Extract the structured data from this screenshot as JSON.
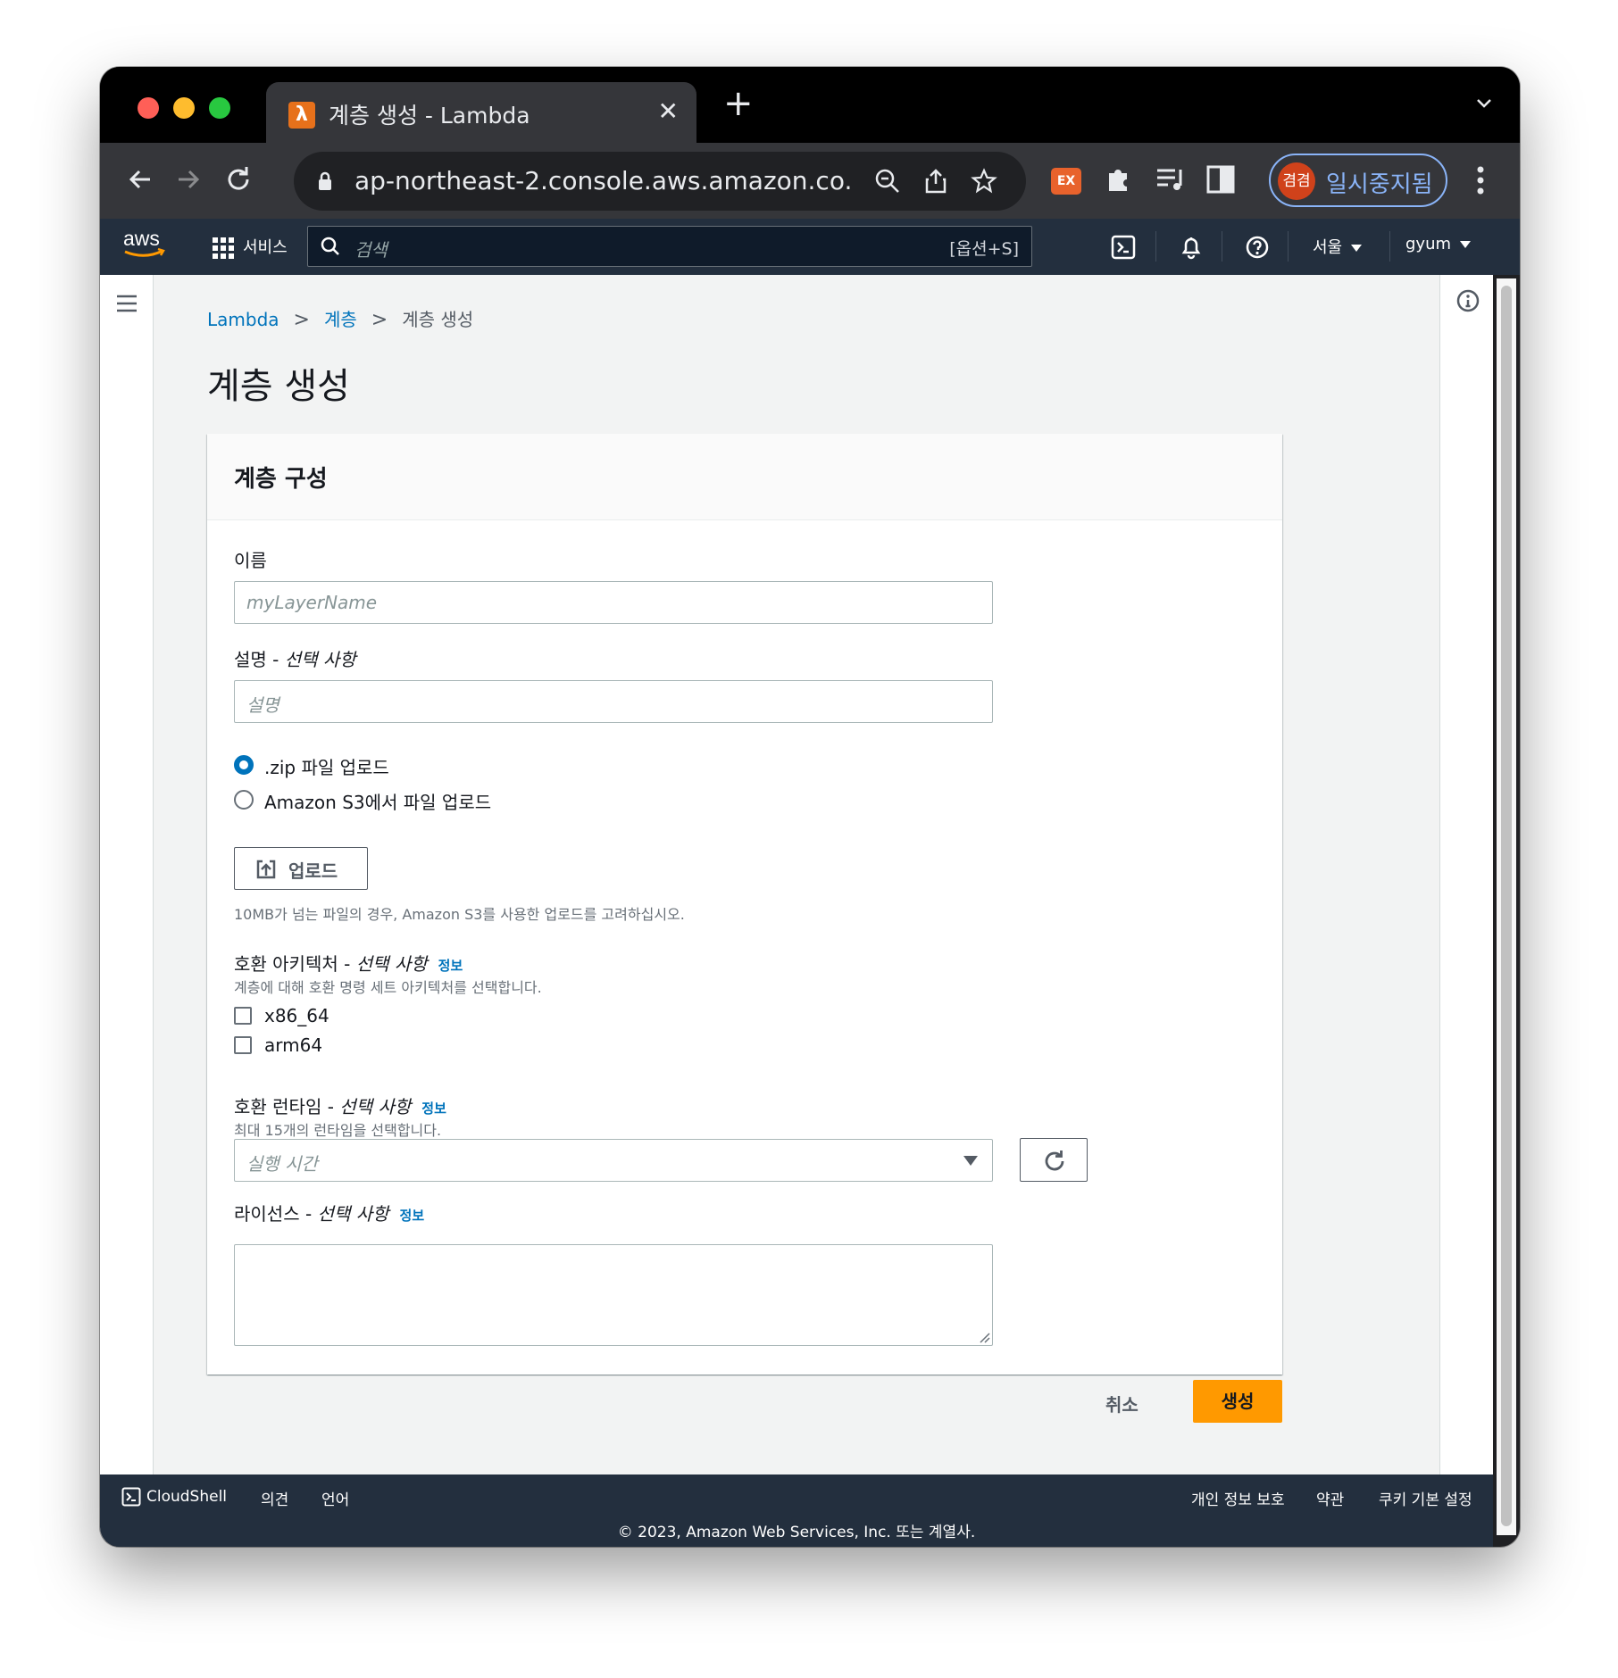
{
  "browser": {
    "tab_title": "계층 생성 - Lambda",
    "tab_close": "✕",
    "new_tab": "+",
    "url": "ap-northeast-2.console.aws.amazon.co...",
    "extension_label": "EX",
    "profile_avatar": "겸겸",
    "profile_status": "일시중지됨"
  },
  "aws_header": {
    "services_label": "서비스",
    "search_placeholder": "검색",
    "search_shortcut": "[옵션+S]",
    "region": "서울",
    "user": "gyum"
  },
  "breadcrumb": {
    "items": [
      "Lambda",
      "계층",
      "계층 생성"
    ]
  },
  "page_title": "계층 생성",
  "form": {
    "container_title": "계층 구성",
    "name_label": "이름",
    "name_placeholder": "myLayerName",
    "description_label": "설명 - ",
    "description_optional": "선택 사항",
    "description_placeholder": "설명",
    "upload_options": [
      {
        "label": ".zip 파일 업로드",
        "selected": true
      },
      {
        "label": "Amazon S3에서 파일 업로드",
        "selected": false
      }
    ],
    "upload_button": "업로드",
    "upload_hint": "10MB가 넘는 파일의 경우, Amazon S3를 사용한 업로드를 고려하십시오.",
    "architectures_label": "호환 아키텍처 - ",
    "architectures_optional": "선택 사항",
    "architectures_info": "정보",
    "architectures_desc": "계층에 대해 호환 명령 세트 아키텍처를 선택합니다.",
    "architectures": [
      {
        "label": "x86_64",
        "checked": false
      },
      {
        "label": "arm64",
        "checked": false
      }
    ],
    "runtimes_label": "호환 런타임 - ",
    "runtimes_optional": "선택 사항",
    "runtimes_info": "정보",
    "runtimes_desc": "최대 15개의 런타임을 선택합니다.",
    "runtimes_placeholder": "실행 시간",
    "license_label": "라이선스 - ",
    "license_optional": "선택 사항",
    "license_info": "정보",
    "license_value": ""
  },
  "actions": {
    "cancel": "취소",
    "create": "생성"
  },
  "footer": {
    "cloudshell": "CloudShell",
    "feedback": "의견",
    "language": "언어",
    "privacy": "개인 정보 보호",
    "terms": "약관",
    "cookie": "쿠키 기본 설정",
    "copyright": "© 2023, Amazon Web Services, Inc. 또는 계열사."
  },
  "colors": {
    "aws_nav": "#232f3e",
    "link": "#0073bb",
    "primary_button": "#ff9900",
    "page_bg": "#f2f3f3"
  }
}
